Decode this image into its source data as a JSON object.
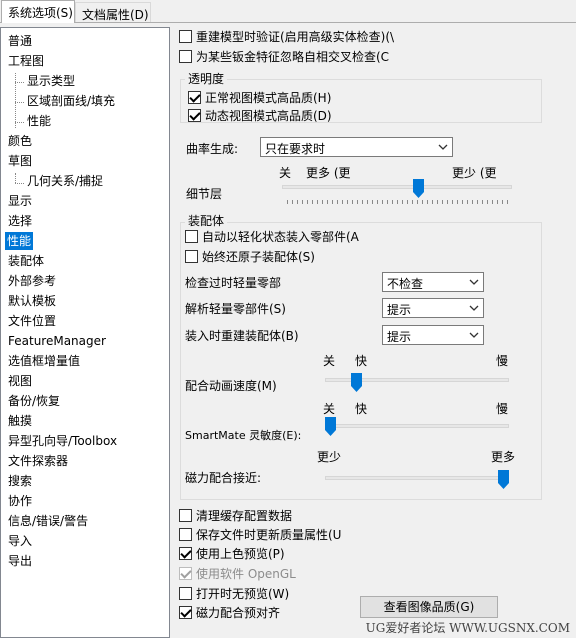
{
  "tabs": [
    {
      "label": "系统选项(S)",
      "active": true
    },
    {
      "label": "文档属性(D)",
      "active": false
    }
  ],
  "nav": {
    "selected": "性能",
    "items": [
      {
        "label": "普通",
        "level": 0
      },
      {
        "label": "工程图",
        "level": 0
      },
      {
        "label": "显示类型",
        "level": 1
      },
      {
        "label": "区域剖面线/填充",
        "level": 1
      },
      {
        "label": "性能",
        "level": 1
      },
      {
        "label": "颜色",
        "level": 0
      },
      {
        "label": "草图",
        "level": 0
      },
      {
        "label": "几何关系/捕捉",
        "level": 1
      },
      {
        "label": "显示",
        "level": 0
      },
      {
        "label": "选择",
        "level": 0
      },
      {
        "label": "性能",
        "level": 0,
        "selected": true
      },
      {
        "label": "装配体",
        "level": 0
      },
      {
        "label": "外部参考",
        "level": 0
      },
      {
        "label": "默认模板",
        "level": 0
      },
      {
        "label": "文件位置",
        "level": 0
      },
      {
        "label": "FeatureManager",
        "level": 0
      },
      {
        "label": "选值框增量值",
        "level": 0
      },
      {
        "label": "视图",
        "level": 0
      },
      {
        "label": "备份/恢复",
        "level": 0
      },
      {
        "label": "触摸",
        "level": 0
      },
      {
        "label": "异型孔向导/Toolbox",
        "level": 0
      },
      {
        "label": "文件探索器",
        "level": 0
      },
      {
        "label": "搜索",
        "level": 0
      },
      {
        "label": "协作",
        "level": 0
      },
      {
        "label": "信息/错误/警告",
        "level": 0
      },
      {
        "label": "导入",
        "level": 0
      },
      {
        "label": "导出",
        "level": 0
      }
    ]
  },
  "performance": {
    "rebuild_verify": {
      "label": "重建模型时验证(启用高级实体检查)(\\",
      "checked": false
    },
    "ignore_self_intersect": {
      "label": "为某些钣金特征忽略自相交叉检查(C",
      "checked": false
    },
    "transparency": {
      "title": "透明度",
      "normal_hq": {
        "label": "正常视图模式高品质(H)",
        "checked": true
      },
      "dynamic_hq": {
        "label": "动态视图模式高品质(D)",
        "checked": true
      }
    },
    "curvature": {
      "label": "曲率生成:",
      "value": "只在要求时"
    },
    "lod": {
      "label": "细节层",
      "left_label": "关",
      "mid_label": "更多 (更",
      "right_label": "更少 (更",
      "value_fraction": 0.6
    }
  },
  "assembly": {
    "title": "装配体",
    "auto_lightweight": {
      "label": "自动以轻化状态装入零部件(A",
      "checked": false
    },
    "always_resolve": {
      "label": "始终还原子装配体(S)",
      "checked": false
    },
    "check_outdated": {
      "label": "检查过时轻量零部",
      "value": "不检查"
    },
    "resolve_lightweight": {
      "label": "解析轻量零部件(S)",
      "value": "提示"
    },
    "rebuild_on_load": {
      "label": "装入时重建装配体(B)",
      "value": "提示"
    },
    "mate_anim_speed": {
      "label": "配合动画速度(M)",
      "off_label": "关",
      "fast_label": "快",
      "slow_label": "慢",
      "value_fraction": 0.15
    },
    "smartmate_sensitivity": {
      "label": "SmartMate 灵敏度(E):",
      "off_label": "关",
      "fast_label": "快",
      "slow_label": "慢",
      "value_fraction": 0.0
    },
    "magnetic_proximity": {
      "label": "磁力配合接近:",
      "less_label": "更少",
      "more_label": "更多",
      "value_fraction": 1.0
    }
  },
  "bottom": {
    "purge_cache": {
      "label": "清理缓存配置数据",
      "checked": false
    },
    "update_quality": {
      "label": "保存文件时更新质量属性(U",
      "checked": false
    },
    "shaded_preview": {
      "label": "使用上色预览(P)",
      "checked": true
    },
    "software_opengl": {
      "label": "使用软件 OpenGL",
      "checked": true,
      "disabled": true
    },
    "no_preview_open": {
      "label": "打开时无预览(W)",
      "checked": false
    },
    "magnetic_presnap": {
      "label": "磁力配合预对齐",
      "checked": true
    },
    "view_image_quality_button": "查看图像品质(G)"
  },
  "watermark": "UG爱好者论坛 WWW.UGSNX.COM"
}
